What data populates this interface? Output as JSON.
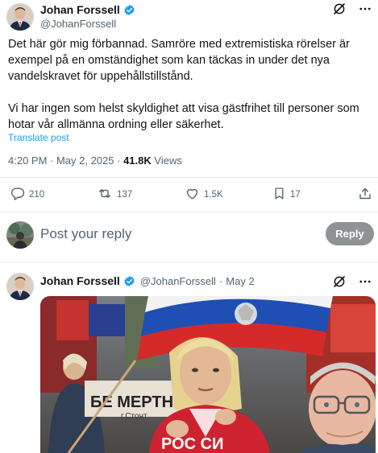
{
  "tweet": {
    "author_name": "Johan Forssell",
    "author_handle": "@JohanForssell",
    "paragraph_1": "Det här gör mig förbannad. Samröre med extremistiska rörelser är exempel på en omständighet som kan täckas in under det nya vandelskravet för uppehållstillstånd.",
    "paragraph_2": "Vi har ingen som helst skyldighet att visa gästfrihet till personer som hotar vår allmänna ordning eller säkerhet.",
    "translate_label": "Translate post",
    "time": "4:20 PM · May 2, 2025 · ",
    "views_count": "41.8K",
    "views_label": " Views",
    "icons": [
      "grok-icon",
      "more-icon"
    ]
  },
  "actions": {
    "replies": "210",
    "reposts": "137",
    "likes": "1.5K",
    "bookmarks": "17"
  },
  "reply_box": {
    "placeholder": "Post your reply",
    "button_label": "Reply"
  },
  "second_tweet": {
    "author_name": "Johan Forssell",
    "author_handle": "@JohanForssell",
    "separator": " · ",
    "date": "May 2"
  },
  "media": {
    "banner_letters_1": "БЕ  МЕРТНИ",
    "banner_letters_2": "г.Стонт",
    "shirt_text": "РОС СИ"
  },
  "colors": {
    "accent": "#1d9bf0",
    "secondary_text": "#536471",
    "reply_button_bg": "#8f9396"
  }
}
